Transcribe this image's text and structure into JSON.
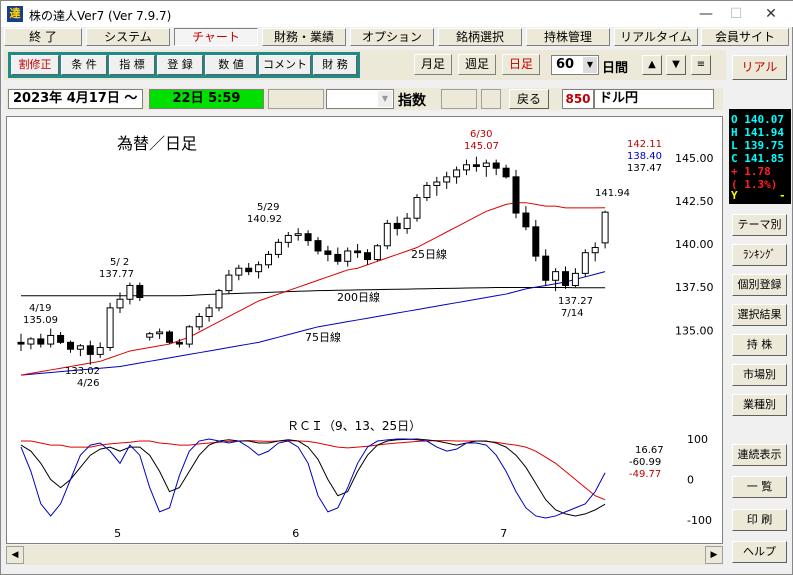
{
  "window": {
    "title": "株の達人Ver7 (Ver 7.9.7)",
    "app_icon_glyph": "達",
    "minimize": "—",
    "maximize": "☐",
    "close": "✕"
  },
  "menu": [
    "終 了",
    "システム",
    "チャート",
    "財務・業績",
    "オプション",
    "銘柄選択",
    "持株管理",
    "リアルタイム",
    "会員サイト"
  ],
  "toolbar": {
    "buttons": [
      "割修正",
      "条 件",
      "指 標",
      "登 録",
      "数 値",
      "コメント",
      "財 務"
    ],
    "periods": [
      "月足",
      "週足",
      "日足"
    ],
    "count": "60",
    "unit": "日間",
    "up": "▲",
    "down": "▼",
    "menu": "≡",
    "riaru": "リアル"
  },
  "info": {
    "date": "2023年 4月17日 ～",
    "time": "22日 5:59",
    "index_label": "指数",
    "back": "戻る",
    "code": "850",
    "name": "ドル円"
  },
  "chart_labels": {
    "title": "為替／日足",
    "ma25": "25日線",
    "ma75": "75日線",
    "ma200": "200日線",
    "rci_title": "ＲＣＩ（9、13、25日）",
    "ann_419_date": "4/19",
    "ann_419_val": "135.09",
    "ann_52_date": "5/ 2",
    "ann_52_val": "137.77",
    "ann_529_date": "5/29",
    "ann_529_val": "140.92",
    "ann_630_date": "6/30",
    "ann_630_val": "145.07",
    "ann_426_val": "133.02",
    "ann_426_date": "4/26",
    "ann_714_val": "137.27",
    "ann_714_date": "7/14",
    "last_close": "141.94",
    "ma_v1": "142.11",
    "ma_v2": "138.40",
    "ma_v3": "137.47",
    "rci_v1": "16.67",
    "rci_v2": "-60.99",
    "rci_v3": "-49.77",
    "x_ticks": [
      "5",
      "6",
      "7"
    ],
    "y_ticks": [
      "145.00",
      "142.50",
      "140.00",
      "137.50",
      "135.00"
    ],
    "rci_ticks": [
      "100",
      "0",
      "-100"
    ]
  },
  "colors": {
    "ma25": "#e00000",
    "ma75": "#0000c0",
    "ma200": "#000000",
    "rci9": "#0000c0",
    "rci13": "#000000",
    "rci25": "#e00000",
    "candle_up": "#ffffff",
    "candle_down": "#000000"
  },
  "ohlc": {
    "o": "O 140.07",
    "h": "H 141.94",
    "l": "L 139.75",
    "c": "C 141.85",
    "chg": "+ 1.78",
    "pct": "( 1.3%)",
    "y": "Y",
    "y_val": "-"
  },
  "sidebar_buttons": [
    "テーマ別",
    "ﾗﾝｷﾝｸﾞ",
    "個別登録",
    "選択結果",
    "持 株",
    "市場別",
    "業種別",
    "連続表示",
    "一 覧",
    "印 刷",
    "ヘルプ"
  ],
  "chart_data": {
    "type": "candlestick",
    "title": "為替／日足",
    "y_range": [
      132,
      146.5
    ],
    "x_labels": [
      "5",
      "6",
      "7"
    ],
    "candles": [
      [
        134.3,
        134.8,
        133.8,
        134.2
      ],
      [
        134.2,
        134.6,
        133.9,
        134.5
      ],
      [
        134.5,
        134.8,
        134.0,
        134.2
      ],
      [
        134.2,
        135.1,
        134.0,
        134.7
      ],
      [
        134.7,
        134.9,
        134.2,
        134.3
      ],
      [
        134.3,
        134.4,
        133.7,
        133.9
      ],
      [
        133.9,
        134.2,
        133.5,
        134.1
      ],
      [
        134.1,
        134.4,
        133.0,
        133.6
      ],
      [
        133.6,
        134.3,
        133.4,
        134.0
      ],
      [
        134.0,
        136.6,
        133.8,
        136.3
      ],
      [
        136.3,
        137.2,
        136.0,
        136.8
      ],
      [
        136.8,
        137.77,
        136.5,
        137.6
      ],
      [
        137.6,
        137.77,
        136.7,
        136.9
      ],
      [
        134.6,
        134.9,
        134.4,
        134.8
      ],
      [
        134.8,
        135.1,
        134.5,
        134.9
      ],
      [
        134.9,
        135.0,
        134.2,
        134.3
      ],
      [
        134.3,
        134.5,
        134.0,
        134.2
      ],
      [
        134.2,
        135.3,
        134.0,
        135.2
      ],
      [
        135.2,
        136.0,
        135.0,
        135.8
      ],
      [
        135.8,
        136.5,
        135.5,
        136.3
      ],
      [
        136.3,
        137.4,
        136.1,
        137.3
      ],
      [
        137.3,
        138.5,
        137.1,
        138.2
      ],
      [
        138.2,
        138.8,
        137.9,
        138.6
      ],
      [
        138.6,
        138.9,
        138.2,
        138.4
      ],
      [
        138.4,
        139.0,
        138.0,
        138.8
      ],
      [
        138.8,
        139.6,
        138.6,
        139.4
      ],
      [
        139.4,
        140.3,
        139.2,
        140.1
      ],
      [
        140.1,
        140.7,
        139.8,
        140.5
      ],
      [
        140.5,
        140.92,
        140.2,
        140.6
      ],
      [
        140.6,
        140.8,
        139.9,
        140.2
      ],
      [
        140.2,
        140.4,
        139.4,
        139.6
      ],
      [
        139.6,
        139.9,
        139.0,
        139.4
      ],
      [
        139.4,
        139.8,
        138.8,
        139.0
      ],
      [
        139.0,
        139.8,
        138.7,
        139.6
      ],
      [
        139.6,
        140.0,
        139.2,
        139.5
      ],
      [
        139.5,
        139.7,
        138.8,
        139.1
      ],
      [
        139.1,
        140.0,
        139.0,
        139.9
      ],
      [
        139.9,
        141.4,
        139.7,
        141.2
      ],
      [
        141.2,
        141.6,
        140.5,
        140.9
      ],
      [
        140.9,
        141.8,
        140.6,
        141.5
      ],
      [
        141.5,
        142.9,
        141.3,
        142.7
      ],
      [
        142.7,
        143.6,
        142.5,
        143.4
      ],
      [
        143.4,
        143.9,
        142.8,
        143.6
      ],
      [
        143.6,
        144.2,
        143.2,
        143.9
      ],
      [
        143.9,
        144.5,
        143.5,
        144.3
      ],
      [
        144.3,
        144.9,
        144.0,
        144.6
      ],
      [
        144.6,
        145.07,
        144.2,
        144.5
      ],
      [
        144.5,
        144.9,
        143.9,
        144.7
      ],
      [
        144.7,
        144.9,
        144.0,
        144.4
      ],
      [
        144.4,
        144.6,
        143.8,
        143.9
      ],
      [
        143.9,
        144.3,
        141.5,
        141.8
      ],
      [
        141.8,
        142.2,
        140.8,
        141.0
      ],
      [
        141.0,
        141.4,
        139.0,
        139.3
      ],
      [
        139.3,
        139.7,
        137.6,
        137.9
      ],
      [
        137.9,
        138.6,
        137.27,
        138.4
      ],
      [
        138.4,
        138.7,
        137.4,
        137.6
      ],
      [
        137.6,
        138.6,
        137.5,
        138.3
      ],
      [
        138.3,
        139.7,
        138.1,
        139.5
      ],
      [
        139.5,
        140.1,
        139.0,
        139.8
      ],
      [
        140.07,
        141.94,
        139.75,
        141.85
      ]
    ],
    "ma25": [
      132.4,
      132.5,
      132.6,
      132.7,
      132.8,
      132.9,
      133.0,
      133.1,
      133.2,
      133.4,
      133.6,
      133.8,
      133.9,
      134.0,
      134.1,
      134.2,
      134.4,
      134.6,
      134.9,
      135.2,
      135.5,
      135.8,
      136.1,
      136.4,
      136.7,
      136.9,
      137.1,
      137.3,
      137.5,
      137.7,
      137.9,
      138.1,
      138.3,
      138.5,
      138.6,
      138.8,
      139.0,
      139.2,
      139.4,
      139.6,
      139.8,
      140.1,
      140.4,
      140.7,
      141.0,
      141.3,
      141.6,
      141.9,
      142.1,
      142.3,
      142.4,
      142.4,
      142.3,
      142.2,
      142.2,
      142.1,
      142.1,
      142.1,
      142.1,
      142.11
    ],
    "ma75": [
      132.4,
      132.45,
      132.5,
      132.55,
      132.6,
      132.65,
      132.7,
      132.75,
      132.8,
      132.85,
      132.9,
      133.0,
      133.1,
      133.2,
      133.3,
      133.4,
      133.5,
      133.6,
      133.7,
      133.8,
      133.9,
      134.0,
      134.1,
      134.2,
      134.3,
      134.45,
      134.6,
      134.75,
      134.9,
      135.05,
      135.2,
      135.3,
      135.4,
      135.5,
      135.6,
      135.7,
      135.8,
      135.9,
      136.0,
      136.1,
      136.2,
      136.3,
      136.4,
      136.5,
      136.6,
      136.7,
      136.8,
      136.9,
      137.0,
      137.1,
      137.25,
      137.4,
      137.5,
      137.6,
      137.7,
      137.8,
      137.95,
      138.1,
      138.25,
      138.4
    ],
    "ma200": [
      137.0,
      137.0,
      137.0,
      137.0,
      137.0,
      137.0,
      137.0,
      137.0,
      137.0,
      137.0,
      137.0,
      137.0,
      137.0,
      137.0,
      137.0,
      137.0,
      137.0,
      137.02,
      137.05,
      137.08,
      137.1,
      137.12,
      137.14,
      137.16,
      137.18,
      137.2,
      137.22,
      137.24,
      137.26,
      137.28,
      137.3,
      137.31,
      137.32,
      137.33,
      137.34,
      137.35,
      137.36,
      137.37,
      137.38,
      137.39,
      137.4,
      137.41,
      137.42,
      137.43,
      137.44,
      137.45,
      137.46,
      137.47,
      137.48,
      137.48,
      137.48,
      137.48,
      137.48,
      137.48,
      137.48,
      137.48,
      137.47,
      137.47,
      137.47,
      137.47
    ],
    "rci": {
      "y_range": [
        -100,
        100
      ],
      "rci9": [
        80,
        20,
        -60,
        -90,
        -60,
        0,
        60,
        85,
        90,
        70,
        40,
        85,
        60,
        -20,
        -80,
        -70,
        10,
        70,
        95,
        100,
        95,
        90,
        95,
        80,
        60,
        70,
        90,
        95,
        80,
        40,
        -40,
        -80,
        -70,
        -20,
        40,
        80,
        95,
        98,
        100,
        100,
        98,
        95,
        80,
        70,
        75,
        90,
        90,
        85,
        60,
        20,
        -30,
        -70,
        -90,
        -95,
        -90,
        -80,
        -70,
        -60,
        -30,
        16.67
      ],
      "rci13": [
        85,
        70,
        40,
        0,
        -20,
        0,
        30,
        60,
        75,
        80,
        70,
        80,
        80,
        60,
        20,
        -30,
        -20,
        20,
        60,
        85,
        95,
        98,
        95,
        95,
        90,
        90,
        95,
        98,
        95,
        80,
        50,
        0,
        -40,
        -30,
        20,
        60,
        85,
        95,
        98,
        99,
        100,
        98,
        95,
        90,
        85,
        90,
        95,
        95,
        90,
        80,
        60,
        30,
        -10,
        -50,
        -75,
        -85,
        -90,
        -85,
        -75,
        -60.99
      ],
      "rci25": [
        95,
        95,
        90,
        85,
        85,
        80,
        80,
        80,
        85,
        88,
        90,
        92,
        95,
        95,
        90,
        88,
        85,
        85,
        88,
        90,
        92,
        94,
        95,
        96,
        95,
        94,
        95,
        96,
        95,
        94,
        90,
        85,
        80,
        78,
        80,
        82,
        85,
        88,
        90,
        92,
        94,
        95,
        96,
        96,
        95,
        95,
        95,
        94,
        92,
        88,
        85,
        80,
        70,
        55,
        40,
        20,
        0,
        -20,
        -40,
        -49.77
      ]
    }
  }
}
